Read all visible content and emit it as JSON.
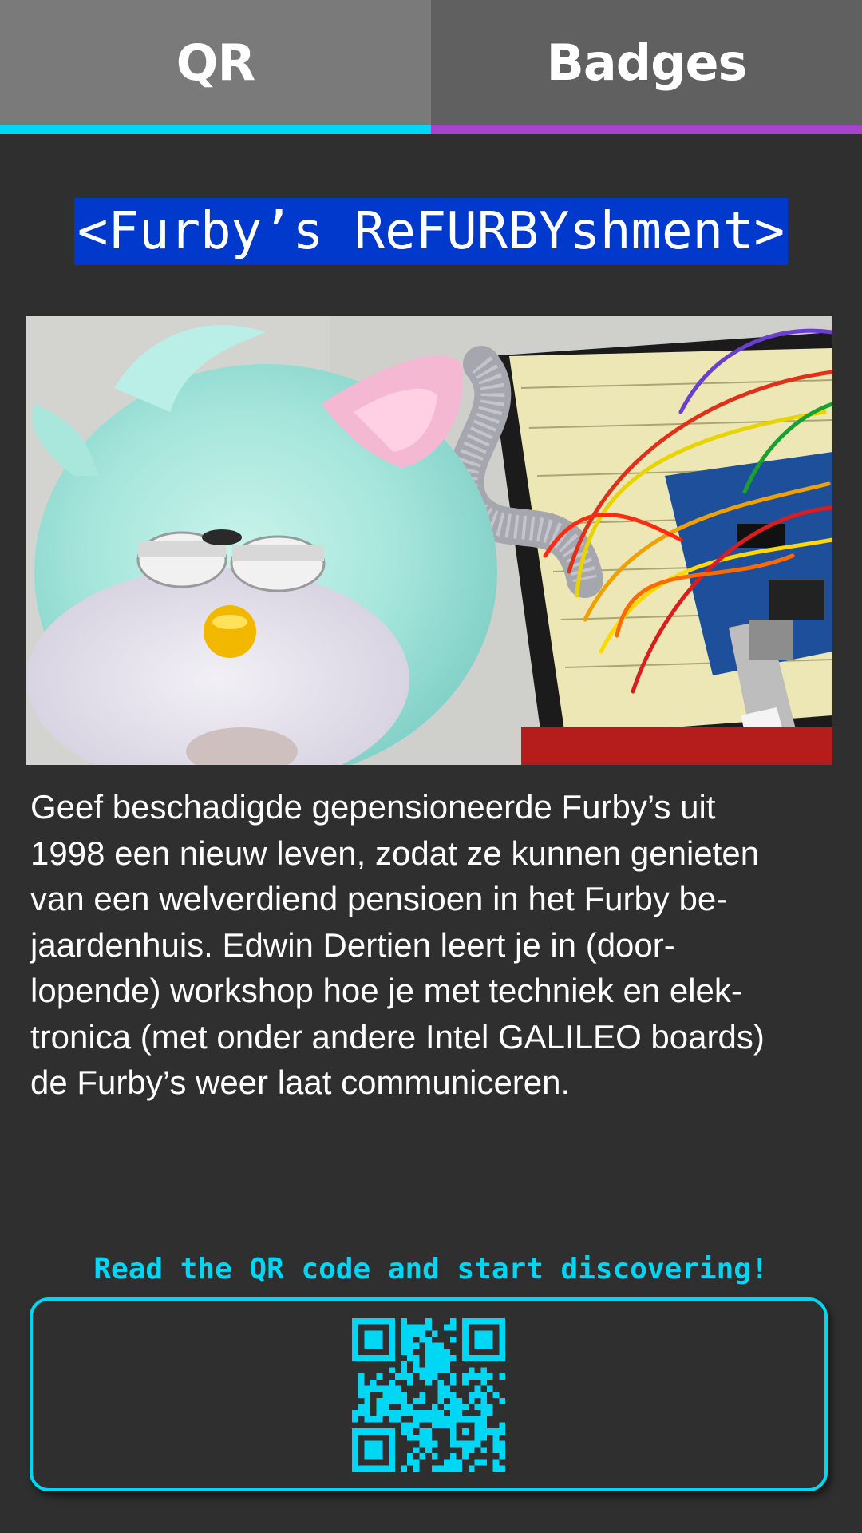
{
  "tabs": [
    {
      "label": "QR",
      "active": true,
      "accent_color": "#00d7f5"
    },
    {
      "label": "Badges",
      "active": false,
      "accent_color": "#a545c9"
    }
  ],
  "title": "<Furby’s ReFURBYshment>",
  "photo": {
    "alt": "Furby toy connected to a breadboard with Arduino board"
  },
  "description": "Geef beschadigde gepensioneerde Furby’s uit 1998 een nieuw leven, zodat ze kunnen genieten van een welverdiend pensioen in het Furby be-jaardenhuis. Edwin Dertien leert je in (door-lopende) workshop hoe je met techniek en elek-tronica (met onder andere Intel GALILEO boards) de Furby’s weer laat communiceren.",
  "description_lines": [
    "Geef beschadigde gepensioneerde Furby’s uit",
    "1998 een nieuw leven, zodat ze kunnen genieten",
    "van een welverdiend pensioen in het Furby be-",
    "jaardenhuis. Edwin Dertien leert je in (door-",
    "lopende) workshop hoe je met techniek en elek-",
    "tronica (met onder andere Intel GALILEO boards)",
    "de Furby’s weer laat communiceren."
  ],
  "cta": "Read the QR code and start discovering!",
  "colors": {
    "background": "#2f2f2f",
    "accent_cyan": "#00d7f5",
    "accent_purple": "#a545c9",
    "title_background": "#0039cc"
  },
  "icons": {
    "qr": "qr-code-icon"
  }
}
